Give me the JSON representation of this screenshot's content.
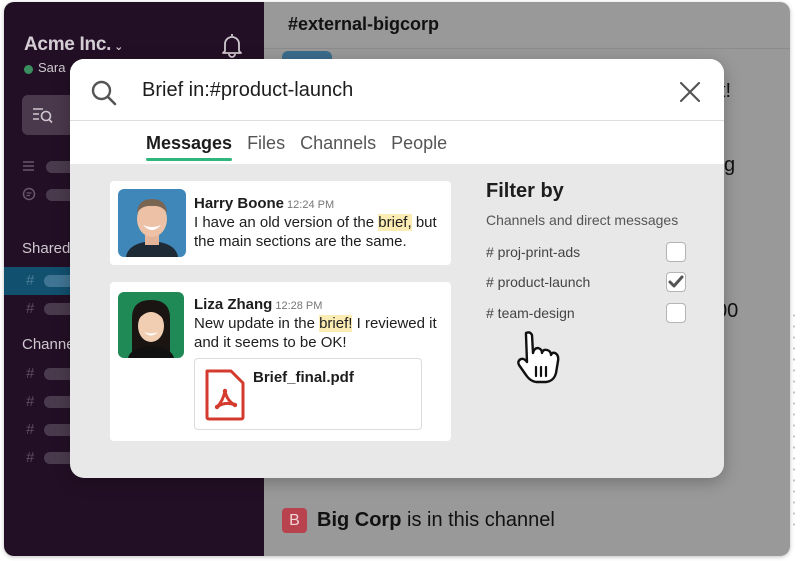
{
  "sidebar": {
    "workspace_name": "Acme Inc.",
    "workspace_chevron": "⌄",
    "user_name": "Sara",
    "user_status_color": "#3b8f5f",
    "search_icon": "search-list-icon",
    "nav_icons": [
      "list-icon",
      "threads-icon"
    ],
    "sections": [
      {
        "label": "Shared",
        "channel_count": 2,
        "active_index": 0
      },
      {
        "label": "Channels",
        "channel_count": 4
      }
    ],
    "channel_prefix": "#"
  },
  "main": {
    "channel_title": "#external-bigcorp",
    "background_fragments": [
      "t!",
      "g",
      "00"
    ],
    "bigcorp_badge": "B",
    "bigcorp_name": "Big Corp",
    "bigcorp_suffix": " is in this channel"
  },
  "search_modal": {
    "query": "Brief in:#product-launch",
    "tabs": [
      {
        "label": "Messages",
        "active": true
      },
      {
        "label": "Files",
        "active": false
      },
      {
        "label": "Channels",
        "active": false
      },
      {
        "label": "People",
        "active": false
      }
    ],
    "results": [
      {
        "author": "Harry Boone",
        "time": "12:24 PM",
        "text_before": "I have an old version of the ",
        "highlight": "brief,",
        "text_after": " but the main sections are the same.",
        "avatar_bg": "#3f87b8"
      },
      {
        "author": "Liza Zhang",
        "time": "12:28 PM",
        "text_before": "New update in the ",
        "highlight": "brief!",
        "text_after": " I reviewed it and it seems to be OK!",
        "avatar_bg": "#1f8a55",
        "attachment": {
          "name": "Brief_final.pdf",
          "icon": "pdf-icon"
        }
      }
    ],
    "filter": {
      "title": "Filter by",
      "subtitle": "Channels and direct messages",
      "options": [
        {
          "label": "# proj-print-ads",
          "checked": false
        },
        {
          "label": "# product-launch",
          "checked": true
        },
        {
          "label": "# team-design",
          "checked": false
        }
      ]
    }
  },
  "colors": {
    "sidebar_bg": "#230f25",
    "active_channel": "#11506f",
    "tab_underline": "#2eb67d",
    "highlight": "#fbecb4",
    "pdf_red": "#d43b2e",
    "bigcorp_red": "#b8434f"
  }
}
